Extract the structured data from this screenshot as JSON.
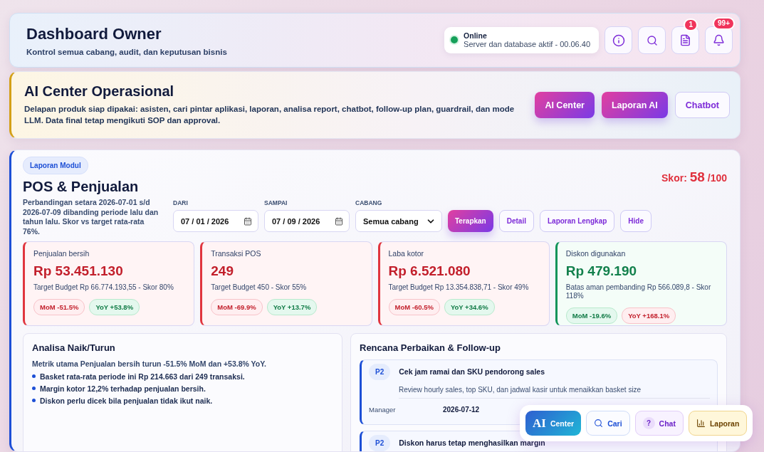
{
  "header": {
    "title": "Dashboard Owner",
    "subtitle": "Kontrol semua cabang, audit, dan keputusan bisnis",
    "status": {
      "label": "Online",
      "detail": "Server dan database aktif - 00.06.40",
      "online": true
    },
    "actions": [
      {
        "kind": "info"
      },
      {
        "kind": "search"
      },
      {
        "kind": "report",
        "badge": "1"
      },
      {
        "kind": "bell",
        "badge": "99+"
      }
    ]
  },
  "ai_banner": {
    "title": "AI Center Operasional",
    "text": "Delapan produk siap dipakai: asisten, cari pintar aplikasi, laporan, analisa report, chatbot, follow-up plan, guardrail, dan mode LLM. Data final tetap mengikuti SOP dan approval.",
    "buttons": [
      {
        "label": "AI Center",
        "primary": true
      },
      {
        "label": "Laporan AI",
        "primary": true
      },
      {
        "label": "Chatbot",
        "primary": false
      }
    ]
  },
  "module": {
    "badge": "Laporan Modul",
    "title": "POS & Penjualan",
    "description": "Perbandingan setara 2026-07-01 s/d 2026-07-09 dibanding periode lalu dan tahun lalu. Skor vs target rata-rata 76%.",
    "score": {
      "label": "Skor:",
      "value": "58",
      "max": "/100"
    },
    "filters": [
      {
        "kind": "date",
        "label": "DARI",
        "value": "07 / 01 / 2026"
      },
      {
        "kind": "date",
        "label": "SAMPAI",
        "value": "07 / 09 / 2026"
      },
      {
        "kind": "select",
        "label": "CABANG",
        "value": "Semua cabang"
      }
    ],
    "buttons": [
      {
        "label": "Terapkan",
        "primary": true
      },
      {
        "label": "Detail",
        "primary": false
      },
      {
        "label": "Laporan Lengkap",
        "primary": false
      },
      {
        "label": "Hide",
        "primary": false
      }
    ],
    "metrics": [
      {
        "label": "Penjualan bersih",
        "value": "Rp 53.451.130",
        "note": "Target Budget Rp 66.774.193,55 - Skor 80%",
        "positive": false,
        "chips": [
          {
            "label": "MoM -51.5%",
            "positive": false
          },
          {
            "label": "YoY +53.8%",
            "positive": true
          }
        ]
      },
      {
        "label": "Transaksi POS",
        "value": "249",
        "note": "Target Budget 450 - Skor 55%",
        "positive": false,
        "chips": [
          {
            "label": "MoM -69.9%",
            "positive": false
          },
          {
            "label": "YoY +13.7%",
            "positive": true
          }
        ]
      },
      {
        "label": "Laba kotor",
        "value": "Rp 6.521.080",
        "note": "Target Budget Rp 13.354.838,71 - Skor 49%",
        "positive": false,
        "chips": [
          {
            "label": "MoM -60.5%",
            "positive": false
          },
          {
            "label": "YoY +34.6%",
            "positive": true
          }
        ]
      },
      {
        "label": "Diskon digunakan",
        "value": "Rp 479.190",
        "note": "Batas aman pembanding Rp 566.089,8 - Skor 118%",
        "positive": true,
        "chips": [
          {
            "label": "MoM -19.6%",
            "positive": true
          },
          {
            "label": "YoY +168.1%",
            "positive": false
          }
        ]
      }
    ],
    "analysis": {
      "title": "Analisa Naik/Turun",
      "summary": "Metrik utama Penjualan bersih turun -51.5% MoM dan +53.8% YoY.",
      "points": [
        "Basket rata-rata periode ini Rp 214.663 dari 249 transaksi.",
        "Margin kotor 12,2% terhadap penjualan bersih.",
        "Diskon perlu dicek bila penjualan tidak ikut naik."
      ]
    },
    "plan": {
      "title": "Rencana Perbaikan & Follow-up",
      "items": [
        {
          "priority": "P2",
          "title": "Cek jam ramai dan SKU pendorong sales",
          "description": "Review hourly sales, top SKU, dan jadwal kasir untuk menaikkan basket size",
          "owner": "Manager",
          "due": "2026-07-12"
        },
        {
          "priority": "P2",
          "title": "Diskon harus tetap menghasilkan margin"
        }
      ]
    }
  },
  "dock": [
    {
      "kind": "ai",
      "mark": "AI",
      "label": "Center"
    },
    {
      "kind": "search",
      "label": "Cari"
    },
    {
      "kind": "chat",
      "mark": "?",
      "label": "Chat"
    },
    {
      "kind": "report",
      "label": "Laporan"
    }
  ]
}
